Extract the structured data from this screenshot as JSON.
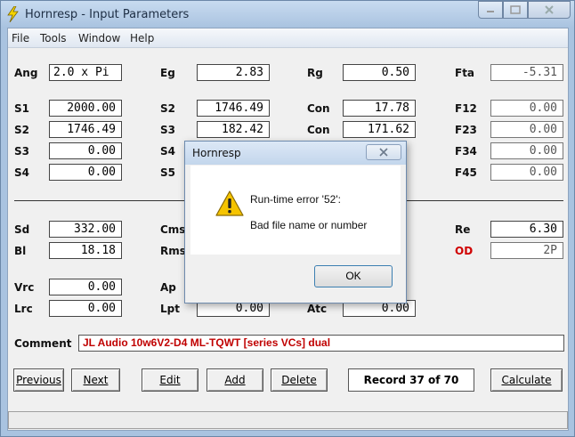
{
  "window": {
    "title": "Hornresp - Input Parameters",
    "close_glyph": "✕"
  },
  "menu": [
    "File",
    "Tools",
    "Window",
    "Help"
  ],
  "params": {
    "ang": {
      "label": "Ang",
      "value": "2.0 x Pi"
    },
    "eg": {
      "label": "Eg",
      "value": "2.83"
    },
    "rg": {
      "label": "Rg",
      "value": "0.50"
    },
    "fta": {
      "label": "Fta",
      "value": "-5.31"
    },
    "s1": {
      "label": "S1",
      "value": "2000.00"
    },
    "s2a": {
      "label": "S2",
      "value": "1746.49"
    },
    "con1": {
      "label": "Con",
      "value": "17.78"
    },
    "f12": {
      "label": "F12",
      "value": "0.00"
    },
    "s2b": {
      "label": "S2",
      "value": "1746.49"
    },
    "s3a": {
      "label": "S3",
      "value": "182.42"
    },
    "con2": {
      "label": "Con",
      "value": "171.62"
    },
    "f23": {
      "label": "F23",
      "value": "0.00"
    },
    "s3b": {
      "label": "S3",
      "value": "0.00"
    },
    "s4a": {
      "label": "S4"
    },
    "f34": {
      "label": "F34",
      "value": "0.00"
    },
    "s4b": {
      "label": "S4",
      "value": "0.00"
    },
    "s5": {
      "label": "S5"
    },
    "f45": {
      "label": "F45",
      "value": "0.00"
    },
    "sd": {
      "label": "Sd",
      "value": "332.00"
    },
    "cms": {
      "label": "Cms"
    },
    "re": {
      "label": "Re",
      "value": "6.30"
    },
    "bl": {
      "label": "Bl",
      "value": "18.18"
    },
    "rms": {
      "label": "Rms"
    },
    "od": {
      "label": "OD",
      "value": "2P"
    },
    "vrc": {
      "label": "Vrc",
      "value": "0.00"
    },
    "ap": {
      "label": "Ap"
    },
    "lrc": {
      "label": "Lrc",
      "value": "0.00"
    },
    "lpt": {
      "label": "Lpt",
      "value": "0.00"
    },
    "atc": {
      "label": "Atc",
      "value": "0.00"
    }
  },
  "comment": {
    "label": "Comment",
    "value": "JL Audio 10w6V2-D4 ML-TQWT [series VCs] dual"
  },
  "buttons": {
    "previous": "Previous",
    "next": "Next",
    "edit": "Edit",
    "add": "Add",
    "delete": "Delete",
    "calculate": "Calculate"
  },
  "record": "Record 37 of 70",
  "dialog": {
    "title": "Hornresp",
    "message": "Run-time error '52':",
    "detail": "Bad file name or number",
    "ok": "OK"
  },
  "colors": {
    "accent": "#d00000",
    "titlebar": "#a9c3e0"
  }
}
